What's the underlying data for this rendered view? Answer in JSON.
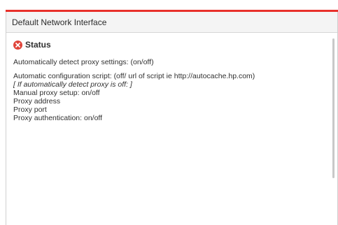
{
  "window": {
    "title": "Default Network Interface"
  },
  "status": {
    "title": "Status",
    "icon": "error-x-icon",
    "icon_color": "#e0443a"
  },
  "content": {
    "line1": "Automatically detect proxy settings: (on/off)",
    "line2": "Automatic configuration script: (off/ url of script ie http://autocache.hp.com)",
    "line3": "[ If automatically detect proxy is off: ]",
    "line4": "Manual proxy setup: on/off",
    "line5": "Proxy address",
    "line6": "Proxy port",
    "line7": "Proxy authentication: on/off"
  },
  "colors": {
    "accent": "#e8302a"
  }
}
